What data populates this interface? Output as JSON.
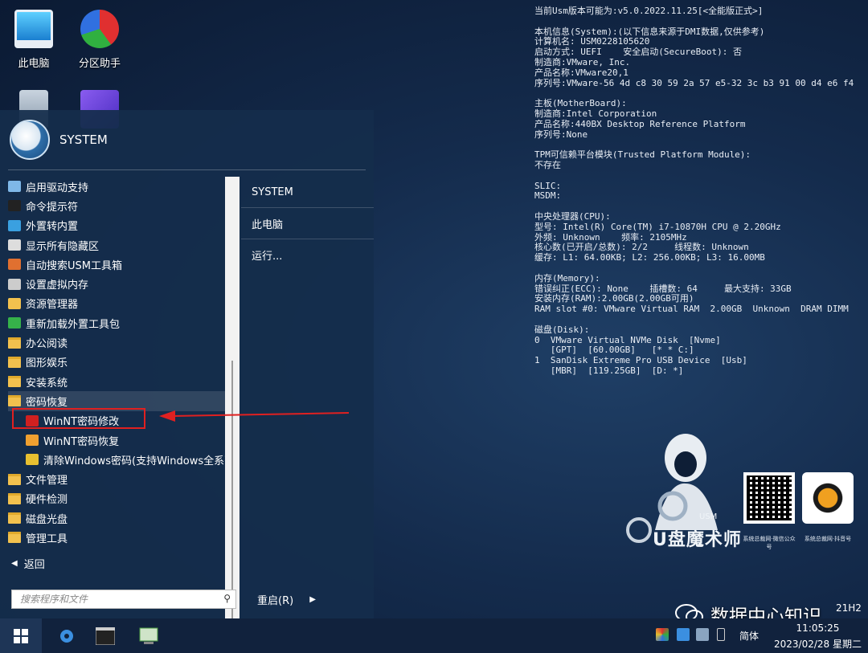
{
  "desktop": {
    "icons": [
      {
        "label": "此电脑",
        "icon": "computer-icon"
      },
      {
        "label": "分区助手",
        "icon": "partition-icon"
      },
      {
        "label": "",
        "icon": "recycle-bin-icon"
      },
      {
        "label": "",
        "icon": "app-icon"
      }
    ]
  },
  "sysinfo": {
    "lines": [
      "当前Usm版本可能为:v5.0.2022.11.25[<全能版正式>]",
      "",
      "本机信息(System):(以下信息来源于DMI数据,仅供参考)",
      "计算机名: USM0228105620",
      "启动方式: UEFI    安全启动(SecureBoot): 否",
      "制造商:VMware, Inc.",
      "产品名称:VMware20,1",
      "序列号:VMware-56 4d c8 30 59 2a 57 e5-32 3c b3 91 00 d4 e6 f4",
      "",
      "主板(MotherBoard):",
      "制造商:Intel Corporation",
      "产品名称:440BX Desktop Reference Platform",
      "序列号:None",
      "",
      "TPM可信赖平台模块(Trusted Platform Module):",
      "不存在",
      "",
      "SLIC:",
      "MSDM:",
      "",
      "中央处理器(CPU):",
      "型号: Intel(R) Core(TM) i7-10870H CPU @ 2.20GHz",
      "外频: Unknown    频率: 2105MHz",
      "核心数(已开启/总数): 2/2     线程数: Unknown",
      "缓存: L1: 64.00KB; L2: 256.00KB; L3: 16.00MB",
      "",
      "内存(Memory):",
      "错误纠正(ECC): None    插槽数: 64     最大支持: 33GB",
      "安装内存(RAM):2.00GB(2.00GB可用)",
      "RAM slot #0: VMware Virtual RAM  2.00GB  Unknown  DRAM DIMM",
      "",
      "磁盘(Disk):",
      "0  VMware Virtual NVMe Disk  [Nvme]",
      "   [GPT]  [60.00GB]   [* * C:]",
      "1  SanDisk Extreme Pro USB Device  [Usb]",
      "   [MBR]  [119.25GB]  [D: *]"
    ]
  },
  "brand": {
    "logo_text": "U盘魔术师",
    "logo_sub": "USM"
  },
  "qr": [
    {
      "caption": "系统总裁网·微信公众号"
    },
    {
      "caption": "系统总裁网·抖音号"
    }
  ],
  "start_menu": {
    "user": "SYSTEM",
    "items": [
      {
        "label": "启用驱动支持",
        "icon": "driver-icon",
        "color": "#7fb8e8"
      },
      {
        "label": "命令提示符",
        "icon": "cmd-icon",
        "color": "#222222"
      },
      {
        "label": "外置转内置",
        "icon": "transfer-icon",
        "color": "#3aa0e0"
      },
      {
        "label": "显示所有隐藏区",
        "icon": "eye-icon",
        "color": "#dddddd"
      },
      {
        "label": "自动搜索USM工具箱",
        "icon": "toolbox-icon",
        "color": "#e07030"
      },
      {
        "label": "设置虚拟内存",
        "icon": "memory-icon",
        "color": "#cccccc"
      },
      {
        "label": "资源管理器",
        "icon": "explorer-icon",
        "color": "#f2c14e"
      },
      {
        "label": "重新加载外置工具包",
        "icon": "reload-icon",
        "color": "#36b24a"
      },
      {
        "label": "办公阅读",
        "icon": "folder-icon",
        "color": "#f2c14e"
      },
      {
        "label": "图形娱乐",
        "icon": "folder-icon",
        "color": "#f2c14e"
      },
      {
        "label": "安装系统",
        "icon": "folder-icon",
        "color": "#f2c14e"
      },
      {
        "label": "密码恢复",
        "icon": "folder-icon",
        "color": "#f2c14e"
      },
      {
        "label": "WinNT密码修改",
        "icon": "nt-password-icon",
        "color": "#d02020"
      },
      {
        "label": "WinNT密码恢复",
        "icon": "nt-recover-icon",
        "color": "#f0a030"
      },
      {
        "label": "清除Windows密码(支持Windows全系列",
        "icon": "key-icon",
        "color": "#e8c030"
      },
      {
        "label": "文件管理",
        "icon": "folder-icon",
        "color": "#f2c14e"
      },
      {
        "label": "硬件检测",
        "icon": "folder-icon",
        "color": "#f2c14e"
      },
      {
        "label": "磁盘光盘",
        "icon": "folder-icon",
        "color": "#f2c14e"
      },
      {
        "label": "管理工具",
        "icon": "folder-icon",
        "color": "#f2c14e"
      }
    ],
    "right": [
      {
        "label": "SYSTEM"
      },
      {
        "label": "此电脑"
      },
      {
        "label": "运行..."
      }
    ],
    "back_label": "返回",
    "search_placeholder": "搜索程序和文件",
    "restart_label": "重启(R)"
  },
  "taskbar": {
    "ime": "简体",
    "time": "11:05:25",
    "date": "2023/02/28 星期二",
    "build_partial": "21H2"
  },
  "watermark": {
    "text": "数据中心知识"
  }
}
